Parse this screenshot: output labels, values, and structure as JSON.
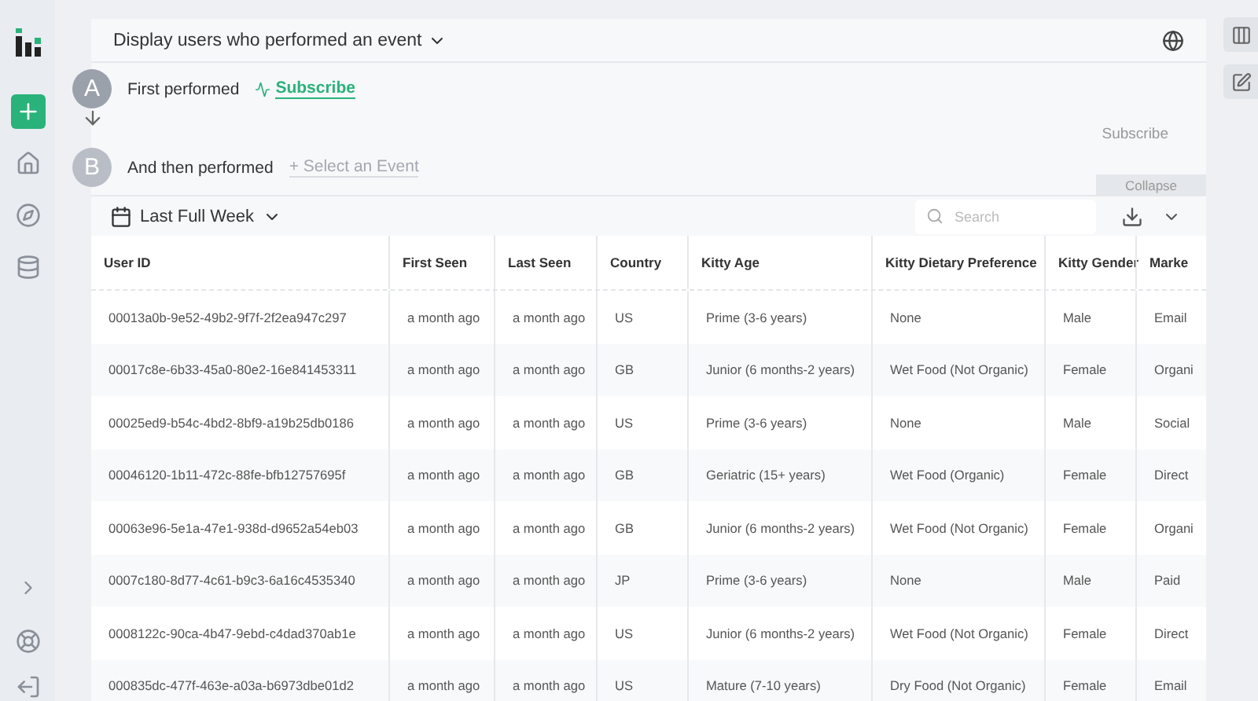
{
  "header": {
    "title": "Display users who performed an event"
  },
  "steps": [
    {
      "letter": "A",
      "label": "First performed",
      "event": "Subscribe",
      "event_set": true
    },
    {
      "letter": "B",
      "label": "And then performed",
      "event": "+ Select an Event",
      "event_set": false
    }
  ],
  "step_action": "Subscribe",
  "collapse": "Collapse",
  "toolbar": {
    "date_range": "Last Full Week",
    "search": {
      "placeholder": "Search"
    }
  },
  "table": {
    "columns": [
      "User ID",
      "First Seen",
      "Last Seen",
      "Country",
      "Kitty Age",
      "Kitty Dietary Preference",
      "Kitty Gender",
      "Marke"
    ],
    "rows": [
      [
        "00013a0b-9e52-49b2-9f7f-2f2ea947c297",
        "a month ago",
        "a month ago",
        "US",
        "Prime (3-6 years)",
        "None",
        "Male",
        "Email"
      ],
      [
        "00017c8e-6b33-45a0-80e2-16e841453311",
        "a month ago",
        "a month ago",
        "GB",
        "Junior (6 months-2 years)",
        "Wet Food (Not Organic)",
        "Female",
        "Organi"
      ],
      [
        "00025ed9-b54c-4bd2-8bf9-a19b25db0186",
        "a month ago",
        "a month ago",
        "US",
        "Prime (3-6 years)",
        "None",
        "Male",
        "Social"
      ],
      [
        "00046120-1b11-472c-88fe-bfb12757695f",
        "a month ago",
        "a month ago",
        "GB",
        "Geriatric (15+ years)",
        "Wet Food (Organic)",
        "Female",
        "Direct"
      ],
      [
        "00063e96-5e1a-47e1-938d-d9652a54eb03",
        "a month ago",
        "a month ago",
        "GB",
        "Junior (6 months-2 years)",
        "Wet Food (Not Organic)",
        "Female",
        "Organi"
      ],
      [
        "0007c180-8d77-4c61-b9c3-6a16c4535340",
        "a month ago",
        "a month ago",
        "JP",
        "Prime (3-6 years)",
        "None",
        "Male",
        "Paid"
      ],
      [
        "0008122c-90ca-4b47-9ebd-c4dad370ab1e",
        "a month ago",
        "a month ago",
        "US",
        "Junior (6 months-2 years)",
        "Wet Food (Not Organic)",
        "Female",
        "Direct"
      ],
      [
        "000835dc-477f-463e-a03a-b6973dbe01d2",
        "a month ago",
        "a month ago",
        "US",
        "Mature (7-10 years)",
        "Dry Food (Not Organic)",
        "Female",
        "Email"
      ]
    ]
  }
}
